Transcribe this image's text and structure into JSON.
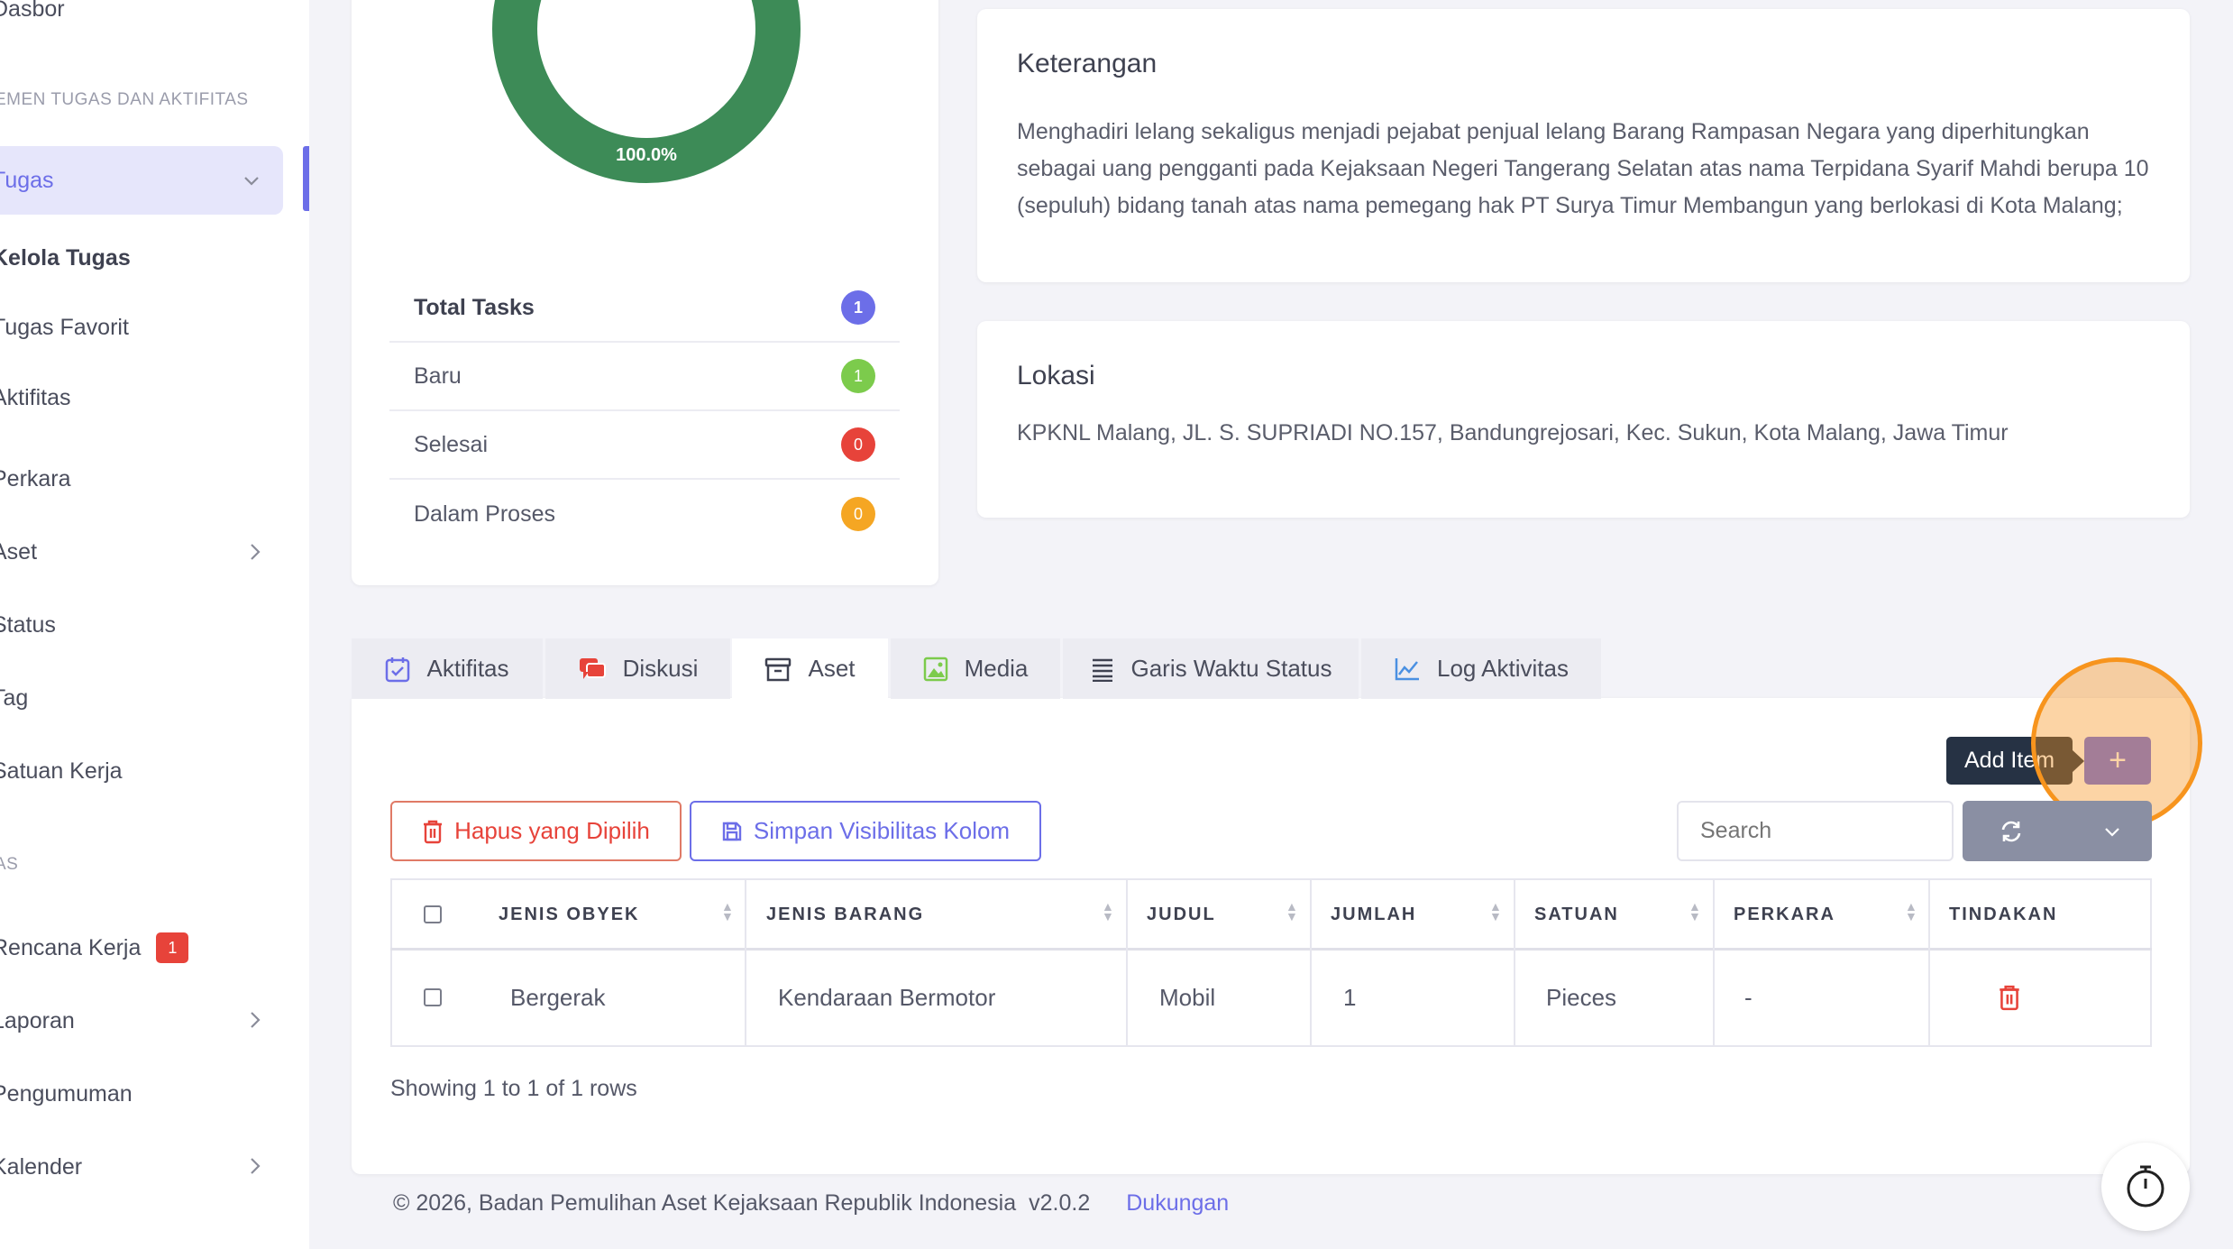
{
  "sidebar": {
    "dasbor": "Dasbor",
    "section_tasks": "EMEN TUGAS DAN AKTIFITAS",
    "tugas": "Tugas",
    "kelola_tugas": "Kelola Tugas",
    "tugas_favorit": "Tugas Favorit",
    "aktifitas": "Aktifitas",
    "perkara": "Perkara",
    "aset": "Aset",
    "status": "Status",
    "tag": "Tag",
    "satuan_kerja": "Satuan Kerja",
    "section_as": "AS",
    "rencana_kerja": "Rencana Kerja",
    "rencana_kerja_badge": "1",
    "laporan": "Laporan",
    "pengumuman": "Pengumuman",
    "kalender": "Kalender"
  },
  "stats": {
    "donut_label": "100.0%",
    "donut_percent": 100,
    "donut_color": "#3d8b57",
    "rows": [
      {
        "label": "Total Tasks",
        "value": "1",
        "color": "#6c6ee8"
      },
      {
        "label": "Baru",
        "value": "1",
        "color": "#7ccb4c"
      },
      {
        "label": "Selesai",
        "value": "0",
        "color": "#e7433a"
      },
      {
        "label": "Dalam Proses",
        "value": "0",
        "color": "#f5a623"
      }
    ]
  },
  "keterangan": {
    "title": "Keterangan",
    "line1": "Menghadiri lelang sekaligus menjadi pejabat penjual lelang Barang Rampasan Negara yang diperhitungkan",
    "line2": "sebagai uang pengganti pada Kejaksaan Negeri Tangerang Selatan atas nama Terpidana Syarif Mahdi berupa 10",
    "line3": "(sepuluh) bidang tanah atas nama pemegang hak PT Surya Timur Membangun yang berlokasi di Kota Malang;"
  },
  "lokasi": {
    "title": "Lokasi",
    "text": "KPKNL Malang, JL. S. SUPRIADI NO.157, Bandungrejosari, Kec. Sukun, Kota Malang, Jawa Timur"
  },
  "tabs": [
    {
      "label": "Aktifitas",
      "icon": "calendar-check-icon"
    },
    {
      "label": "Diskusi",
      "icon": "chat-bubbles-icon"
    },
    {
      "label": "Aset",
      "icon": "archive-box-icon"
    },
    {
      "label": "Media",
      "icon": "image-icon"
    },
    {
      "label": "Garis Waktu Status",
      "icon": "list-lines-icon"
    },
    {
      "label": "Log Aktivitas",
      "icon": "line-chart-icon"
    }
  ],
  "toolbar": {
    "add_item_tooltip": "Add Item",
    "add_button": "+",
    "delete_selected": "Hapus yang Dipilih",
    "save_visibility": "Simpan Visibilitas Kolom",
    "search_placeholder": "Search"
  },
  "table": {
    "headers": [
      "JENIS OBYEK",
      "JENIS BARANG",
      "JUDUL",
      "JUMLAH",
      "SATUAN",
      "PERKARA",
      "TINDAKAN"
    ],
    "rows": [
      {
        "jenis_obyek": "Bergerak",
        "jenis_barang": "Kendaraan Bermotor",
        "judul": "Mobil",
        "jumlah": "1",
        "satuan": "Pieces",
        "perkara": "-"
      }
    ],
    "footer": "Showing 1 to 1 of 1 rows"
  },
  "footer": {
    "copyright": "© 2026, Badan Pemulihan Aset Kejaksaan Republik Indonesia",
    "version": "v2.0.2",
    "support": "Dukungan"
  },
  "colors": {
    "accent": "#6c6ee8",
    "danger": "#e7433a",
    "highlight": "#f7941d"
  }
}
